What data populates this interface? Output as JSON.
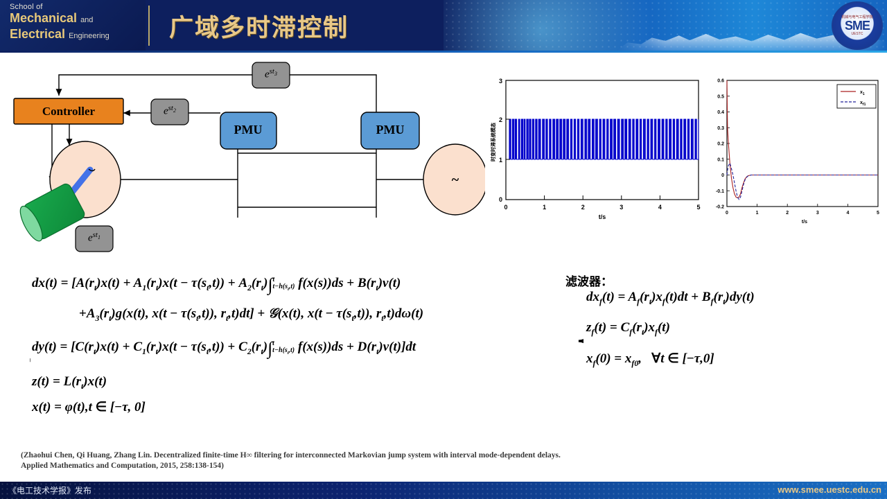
{
  "header": {
    "school_line1": "School of",
    "school_line2_strong": "Mechanical",
    "school_line2_small": "and",
    "school_line3_strong": "Electrical",
    "school_line3_small": "Engineering",
    "title": "广域多时滞控制",
    "logo_cn": "机械与电气工程学院",
    "logo_text": "SME",
    "logo_sub": "UESTC"
  },
  "footer": {
    "left_text": "《电工技术学报》发布",
    "right_text": "www.smee.uestc.edu.cn"
  },
  "diagram": {
    "controller_label": "Controller",
    "pmu_left_label": "PMU",
    "pmu_right_label": "PMU",
    "generator_symbol": "~",
    "delay_1": "e",
    "delay_1_sup": "st",
    "delay_1_sub": "1",
    "delay_2_sub": "2",
    "delay_3_sub": "3",
    "colors": {
      "controller_fill": "#E8821E",
      "pmu_fill": "#5B9BD5",
      "delay_fill": "#939393",
      "bus_fill": "#FBE0CE",
      "load_fill": "#16A44A",
      "rotor_blue": "#4472E8",
      "line": "#000000"
    }
  },
  "chart_data": [
    {
      "type": "line",
      "name": "mode-switching-signal",
      "title": "",
      "xlabel": "t/s",
      "ylabel": "时变时滞系统模态",
      "xlim": [
        0,
        5
      ],
      "ylim": [
        0,
        3
      ],
      "xticks": [
        0,
        1,
        2,
        3,
        4,
        5
      ],
      "yticks": [
        0,
        1,
        2,
        3
      ],
      "grid": false,
      "series": [
        {
          "name": "r(t)",
          "color": "#0000CC",
          "style": "solid",
          "description": "Randomly switching square wave jumping between mode 1 and mode 2 over t in [0,5]",
          "values_low": 1,
          "values_high": 2,
          "switch_times": [
            0.09,
            0.13,
            0.17,
            0.21,
            0.24,
            0.28,
            0.33,
            0.36,
            0.4,
            0.44,
            0.47,
            0.5,
            0.54,
            0.58,
            0.61,
            0.65,
            0.69,
            0.73,
            0.77,
            0.81,
            0.85,
            0.9,
            0.95,
            1.0,
            1.04,
            1.08,
            1.13,
            1.17,
            1.22,
            1.27,
            1.31,
            1.36,
            1.4,
            1.45,
            1.49,
            1.54,
            1.58,
            1.63,
            1.68,
            1.72,
            1.77,
            1.81,
            1.86,
            1.9,
            1.95,
            2.0,
            2.05,
            2.1,
            2.14,
            2.19,
            2.24,
            2.29,
            2.33,
            2.38,
            2.43,
            2.47,
            2.52,
            2.57,
            2.62,
            2.66,
            2.71,
            2.76,
            2.8,
            2.85,
            2.9,
            2.95,
            3.0,
            3.05,
            3.09,
            3.14,
            3.19,
            3.24,
            3.29,
            3.33,
            3.38,
            3.43,
            3.48,
            3.52,
            3.57,
            3.62,
            3.67,
            3.71,
            3.76,
            3.81,
            3.86,
            3.9,
            3.95,
            4.0,
            4.05,
            4.1,
            4.15,
            4.19,
            4.24,
            4.29,
            4.34,
            4.38,
            4.43,
            4.48,
            4.53,
            4.57,
            4.62,
            4.67,
            4.72,
            4.76,
            4.81,
            4.86,
            4.91,
            4.95,
            5.0
          ]
        }
      ]
    },
    {
      "type": "line",
      "name": "state-vs-filter-estimate",
      "title": "",
      "xlabel": "t/s",
      "ylabel": "",
      "xlim": [
        0,
        5
      ],
      "ylim": [
        -0.2,
        0.6
      ],
      "xticks": [
        0,
        1,
        2,
        3,
        4,
        5
      ],
      "yticks": [
        -0.2,
        -0.1,
        0,
        0.1,
        0.2,
        0.3,
        0.4,
        0.5,
        0.6
      ],
      "grid": false,
      "legend_position": "top-right",
      "series": [
        {
          "name": "x1",
          "legend_label": "x",
          "legend_sub": "1",
          "color": "#AA2222",
          "style": "solid",
          "x": [
            0,
            0.02,
            0.05,
            0.1,
            0.15,
            0.2,
            0.25,
            0.3,
            0.35,
            0.4,
            0.45,
            0.5,
            0.55,
            0.6,
            0.65,
            0.7,
            0.8,
            0.9,
            1.0,
            1.5,
            2.0,
            3.0,
            4.0,
            5.0
          ],
          "y": [
            0.6,
            0.3,
            0.2,
            0.07,
            -0.02,
            -0.08,
            -0.12,
            -0.14,
            -0.145,
            -0.14,
            -0.12,
            -0.08,
            -0.05,
            -0.025,
            -0.012,
            -0.005,
            0.0,
            0.0,
            0.0,
            0.0,
            0.0,
            0.0,
            0.0,
            0.0
          ]
        },
        {
          "name": "xf1",
          "legend_label": "x",
          "legend_sub": "f1",
          "color": "#222299",
          "style": "dashed",
          "x": [
            0,
            0.02,
            0.05,
            0.1,
            0.15,
            0.2,
            0.25,
            0.3,
            0.35,
            0.4,
            0.45,
            0.5,
            0.55,
            0.6,
            0.65,
            0.7,
            0.8,
            0.9,
            1.0,
            1.5,
            2.0,
            3.0,
            4.0,
            5.0
          ],
          "y": [
            0.0,
            0.03,
            0.06,
            0.075,
            0.04,
            0.0,
            -0.05,
            -0.1,
            -0.14,
            -0.155,
            -0.14,
            -0.1,
            -0.06,
            -0.03,
            -0.015,
            -0.006,
            0.0,
            0.0,
            0.0,
            0.0,
            0.0,
            0.0,
            0.0,
            0.0
          ]
        }
      ]
    }
  ],
  "equations": {
    "system_title": "",
    "row1": "dx(t) = [A(r_t)x(t) + A_1(r_t)x(t − τ(s_t,t)) + A_2(r_t)∫_{t−h(s_t,t)}^{t} f(x(s))ds + B(r_t)v(t)",
    "row2": "+ A_3(r_t)g(x(t), x(t − τ(s_t,t)), r_t,t)dt] + 𝒢(x(t), x(t − τ(s_t,t)), r_t,t)dω(t)",
    "row3": "dy(t) = [C(r_t)x(t) + C_1(r_t)x(t − τ(s_t,t)) + C_2(r_t)∫_{t−h(s_t,t)}^{t} f(x(s))ds + D(r_t)v(t)]dt",
    "row4": "z(t) = L(r_t)x(t)",
    "row5": "x(t) = φ(t), t ∈ [−τ, 0]",
    "filter_title": "滤波器：",
    "frow1": "dx_f(t) = A_f(r_t)x_f(t)dt + B_f(r_t)dy(t)",
    "frow2": "z_f(t) = C_f(r_t)x_f(t)",
    "frow3": "x_f(0) = x_f0,   ∀t ∈ [−τ,0]"
  },
  "citation": {
    "line1": "(Zhaohui Chen, Qi Huang, Zhang Lin. Decentralized finite-time H∞ filtering for interconnected Markovian jump system with interval mode-dependent delays.",
    "line2": "Applied Mathematics and Computation, 2015, 258:138-154)"
  }
}
